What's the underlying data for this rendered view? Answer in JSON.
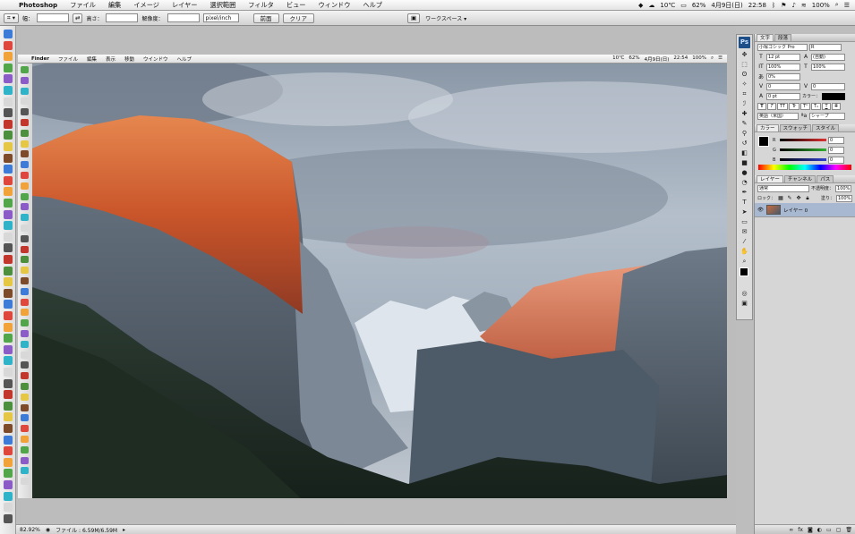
{
  "menubar": {
    "apple": "",
    "app": "Photoshop",
    "items": [
      "ファイル",
      "編集",
      "イメージ",
      "レイヤー",
      "選択範囲",
      "フィルタ",
      "ビュー",
      "ウィンドウ",
      "ヘルプ"
    ],
    "temp": "10℃",
    "battery": "62%",
    "date": "4月9日(日)",
    "time": "22:58",
    "zoom": "100%"
  },
  "options": {
    "width_label": "幅：",
    "height_label": "高さ：",
    "resolution_label": "解像度：",
    "unit": "pixel/inch",
    "front_btn": "前面",
    "clear_btn": "クリア",
    "workspace": "ワークスペース ▾"
  },
  "document": {
    "menubar": {
      "apple": "",
      "app": "Finder",
      "items": [
        "ファイル",
        "編集",
        "表示",
        "移動",
        "ウインドウ",
        "ヘルプ"
      ],
      "temp": "10℃",
      "battery": "62%",
      "date": "4月9日(日)",
      "time": "22:54",
      "zoom": "100%"
    }
  },
  "status": {
    "zoom": "82.92%",
    "file": "ファイル : 6.59M/6.59M"
  },
  "char_panel": {
    "tabs": [
      "文字",
      "段落"
    ],
    "font": "小塚ゴシック Pro",
    "style": "R",
    "size": "12 pt",
    "leading": "(自動)",
    "vscale": "100%",
    "hscale": "100%",
    "tsume": "0%",
    "kerning": "0",
    "tracking": "0",
    "baseline": "0 pt",
    "color_label": "カラー：",
    "lang": "英語（米国）",
    "aa": "シャープ",
    "style_buttons": [
      "T",
      "T",
      "TT",
      "Tr",
      "T¹",
      "T₁",
      "T",
      "T"
    ]
  },
  "color_panel": {
    "tabs": [
      "カラー",
      "スウォッチ",
      "スタイル"
    ],
    "channels": [
      {
        "label": "R",
        "value": "0",
        "color": "#e03030"
      },
      {
        "label": "G",
        "value": "0",
        "color": "#30b030"
      },
      {
        "label": "B",
        "value": "0",
        "color": "#3040d0"
      }
    ]
  },
  "layers_panel": {
    "tabs": [
      "レイヤー",
      "チャンネル",
      "パス"
    ],
    "blend": "通常",
    "opacity_label": "不透明度：",
    "opacity": "100%",
    "lock_label": "ロック：",
    "fill_label": "塗り：",
    "fill": "100%",
    "layer_name": "レイヤー 0"
  }
}
